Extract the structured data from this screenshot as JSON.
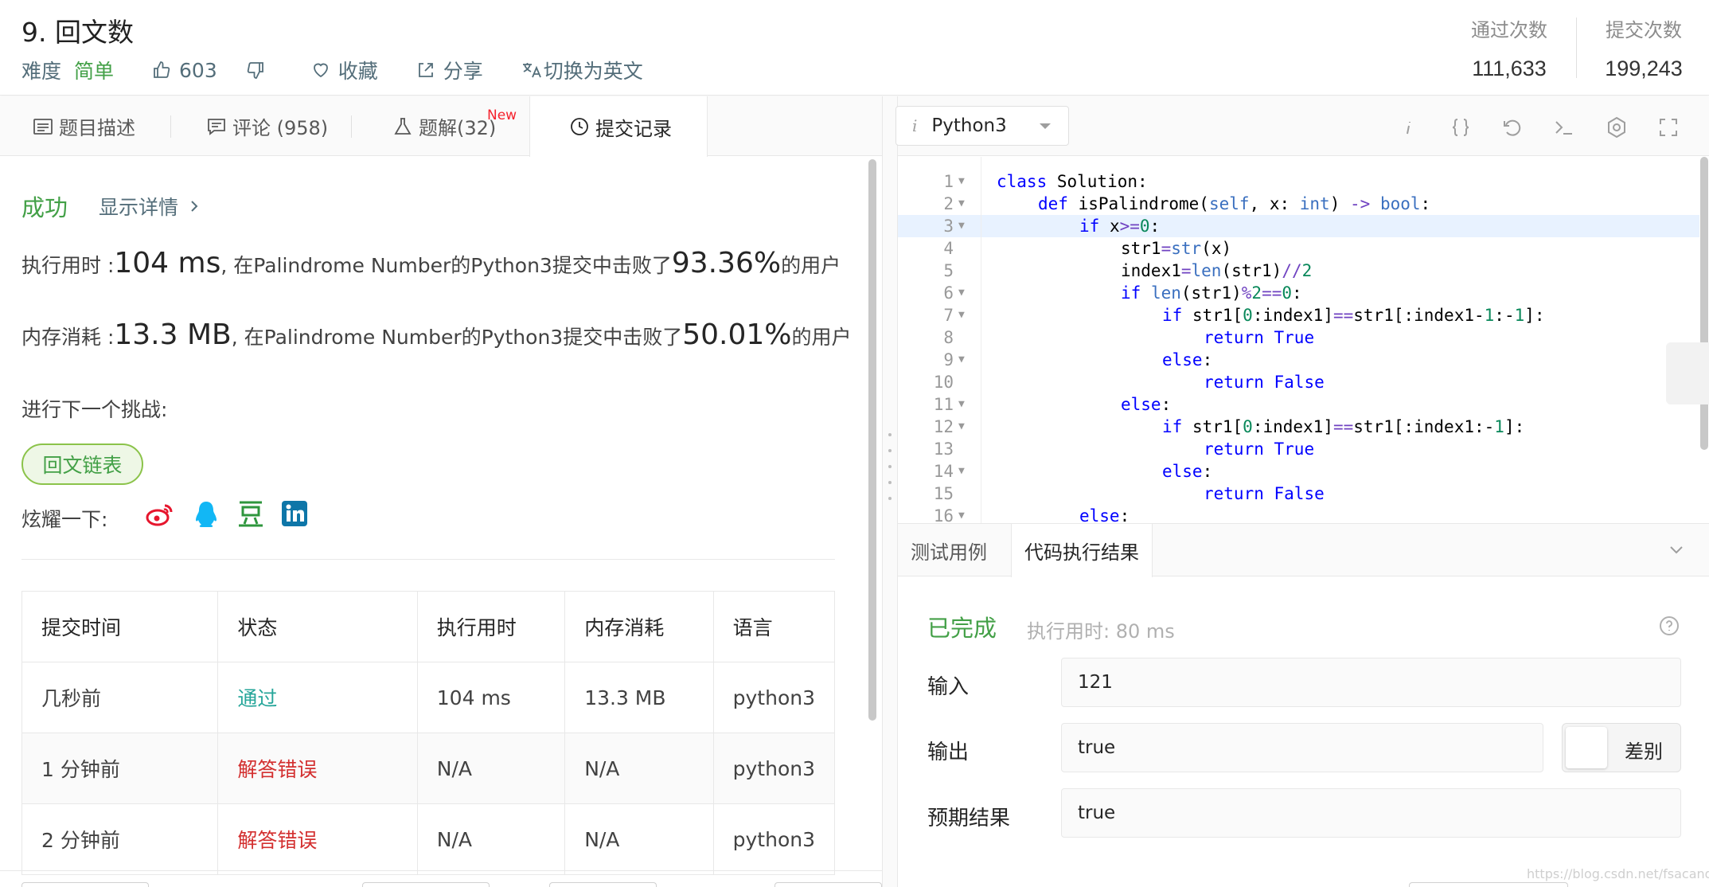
{
  "problem": {
    "title": "9. 回文数",
    "difficulty_label": "难度",
    "difficulty_value": "简单",
    "likes": "603",
    "favorite_label": "收藏",
    "share_label": "分享",
    "switch_lang_label": "切换为英文"
  },
  "stats": {
    "accepted_label": "通过次数",
    "accepted_value": "111,633",
    "submissions_label": "提交次数",
    "submissions_value": "199,243"
  },
  "tabs": {
    "description": "题目描述",
    "comments": "评论 (958)",
    "solutions": "题解(32)",
    "new_badge": "New",
    "submissions": "提交记录"
  },
  "result": {
    "status": "成功",
    "details_link": "显示详情",
    "runtime_prefix": "执行用时 : ",
    "runtime_value": "104 ms",
    "runtime_mid": ", 在Palindrome Number的Python3提交中击败了",
    "runtime_percent": "93.36%",
    "runtime_suffix": " 的用户",
    "memory_prefix": "内存消耗 : ",
    "memory_value": "13.3 MB",
    "memory_mid": ", 在Palindrome Number的Python3提交中击败了",
    "memory_percent": "50.01%",
    "memory_suffix": " 的用户",
    "next_label": "进行下一个挑战:",
    "next_button": "回文链表",
    "share_label": "炫耀一下:"
  },
  "colors": {
    "accent_green": "#43a047",
    "error_red": "#d32f2f",
    "accepted_teal": "#26a69a",
    "weibo": "#e6162d",
    "qq": "#12b7f5",
    "douban": "#2e963d",
    "linkedin": "#0e76a8"
  },
  "submissions_table": {
    "headers": [
      "提交时间",
      "状态",
      "执行用时",
      "内存消耗",
      "语言"
    ],
    "rows": [
      {
        "time": "几秒前",
        "status": "通过",
        "status_type": "accepted",
        "runtime": "104 ms",
        "memory": "13.3 MB",
        "lang": "python3"
      },
      {
        "time": "1 分钟前",
        "status": "解答错误",
        "status_type": "wrong",
        "runtime": "N/A",
        "memory": "N/A",
        "lang": "python3"
      },
      {
        "time": "2 分钟前",
        "status": "解答错误",
        "status_type": "wrong",
        "runtime": "N/A",
        "memory": "N/A",
        "lang": "python3"
      }
    ]
  },
  "editor": {
    "language": "Python3",
    "info_glyph": "i",
    "current_line": 3,
    "lines": [
      {
        "n": "1",
        "fold": true,
        "indent": 0,
        "code": "class Solution:"
      },
      {
        "n": "2",
        "fold": true,
        "indent": 1,
        "code": "def isPalindrome(self, x: int) -> bool:"
      },
      {
        "n": "3",
        "fold": true,
        "indent": 2,
        "code": "if x>=0:"
      },
      {
        "n": "4",
        "fold": false,
        "indent": 3,
        "code": "str1=str(x)"
      },
      {
        "n": "5",
        "fold": false,
        "indent": 3,
        "code": "index1=len(str1)//2"
      },
      {
        "n": "6",
        "fold": true,
        "indent": 3,
        "code": "if len(str1)%2==0:"
      },
      {
        "n": "7",
        "fold": true,
        "indent": 4,
        "code": "if str1[0:index1]==str1[:index1-1:-1]:"
      },
      {
        "n": "8",
        "fold": false,
        "indent": 5,
        "code": "return True"
      },
      {
        "n": "9",
        "fold": true,
        "indent": 4,
        "code": "else:"
      },
      {
        "n": "10",
        "fold": false,
        "indent": 5,
        "code": "return False"
      },
      {
        "n": "11",
        "fold": true,
        "indent": 3,
        "code": "else:"
      },
      {
        "n": "12",
        "fold": true,
        "indent": 4,
        "code": "if str1[0:index1]==str1[:index1:-1]:"
      },
      {
        "n": "13",
        "fold": false,
        "indent": 5,
        "code": "return True"
      },
      {
        "n": "14",
        "fold": true,
        "indent": 4,
        "code": "else:"
      },
      {
        "n": "15",
        "fold": false,
        "indent": 5,
        "code": "return False"
      },
      {
        "n": "16",
        "fold": true,
        "indent": 2,
        "code": "else:"
      }
    ]
  },
  "console": {
    "tab_testcase": "测试用例",
    "tab_result": "代码执行结果",
    "status": "已完成",
    "exec_time": "执行用时: 80 ms",
    "input_label": "输入",
    "input_value": "121",
    "output_label": "输出",
    "output_value": "true",
    "expected_label": "预期结果",
    "expected_value": "true",
    "diff_label": "差别"
  },
  "watermark": "https://blog.csdn.net/fsacandy"
}
